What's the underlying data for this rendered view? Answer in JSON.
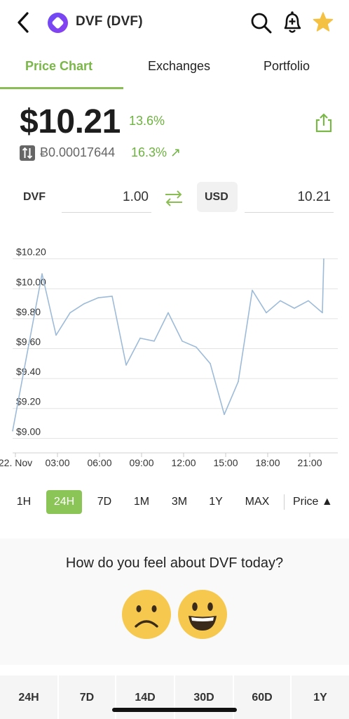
{
  "header": {
    "title": "DVF (DVF)",
    "icons": [
      "back-arrow-icon",
      "coin-logo-icon",
      "search-icon",
      "bell-plus-icon",
      "star-icon"
    ]
  },
  "tabs": [
    {
      "label": "Price Chart",
      "active": true
    },
    {
      "label": "Exchanges",
      "active": false
    },
    {
      "label": "Portfolio",
      "active": false
    }
  ],
  "price": {
    "value": "$10.21",
    "change": "13.6%",
    "btc_value": "Ƀ0.00017644",
    "btc_change": "16.3% ↗"
  },
  "converter": {
    "from_label": "DVF",
    "from_value": "1.00",
    "to_label": "USD",
    "to_value": "10.21"
  },
  "chart_data": {
    "type": "line",
    "y_tick_labels": [
      "$10.20",
      "$10.00",
      "$9.80",
      "$9.60",
      "$9.40",
      "$9.20",
      "$9.00"
    ],
    "ylim": [
      8.95,
      10.25
    ],
    "x_tick_labels": [
      "22. Nov",
      "03:00",
      "06:00",
      "09:00",
      "12:00",
      "15:00",
      "18:00",
      "21:00"
    ],
    "x_hours": [
      0,
      3,
      6,
      9,
      12,
      15,
      18,
      21
    ],
    "xlim": [
      -0.2,
      23.0
    ],
    "series": [
      {
        "color": "#9dbbd9",
        "x": [
          -0.2,
          1.9,
          2.9,
          3.9,
          4.9,
          5.9,
          6.9,
          7.9,
          8.9,
          9.9,
          10.9,
          11.9,
          12.9,
          13.9,
          14.9,
          15.9,
          16.9,
          17.9,
          18.9,
          19.9,
          20.9,
          21.9,
          22.0
        ],
        "values": [
          9.05,
          10.1,
          9.69,
          9.84,
          9.9,
          9.94,
          9.95,
          9.49,
          9.67,
          9.65,
          9.84,
          9.65,
          9.61,
          9.5,
          9.16,
          9.38,
          9.99,
          9.84,
          9.92,
          9.87,
          9.92,
          9.84,
          10.2
        ]
      }
    ],
    "grid": true
  },
  "ranges": {
    "items": [
      "1H",
      "24H",
      "7D",
      "1M",
      "3M",
      "1Y",
      "MAX"
    ],
    "active": "24H",
    "price_toggle": "Price ▲"
  },
  "sentiment": {
    "question": "How do you feel about DVF today?",
    "options": [
      "sad-face-icon",
      "happy-face-icon"
    ]
  },
  "periods": [
    "24H",
    "7D",
    "14D",
    "30D",
    "60D",
    "1Y"
  ]
}
